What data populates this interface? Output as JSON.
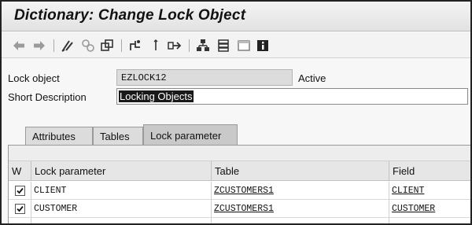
{
  "window": {
    "title": "Dictionary: Change Lock Object"
  },
  "toolbar": {
    "icons": [
      "back-arrow-icon",
      "forward-arrow-icon",
      "display-change-icon",
      "activate-icon",
      "check-icon",
      "where-used-icon",
      "other-object-icon",
      "navigate-icon",
      "object-list-icon",
      "hierarchy-icon",
      "stack-icon",
      "fullscreen-icon",
      "info-icon"
    ]
  },
  "form": {
    "lock_object_label": "Lock object",
    "lock_object_value": "EZLOCK12",
    "status": "Active",
    "short_desc_label": "Short Description",
    "short_desc_value": "Locking Objects"
  },
  "tabs": [
    {
      "label": "Attributes",
      "active": false
    },
    {
      "label": "Tables",
      "active": false
    },
    {
      "label": "Lock parameter",
      "active": true
    }
  ],
  "table": {
    "headers": [
      "W",
      "Lock parameter",
      "Table",
      "Field"
    ],
    "rows": [
      {
        "checked": true,
        "param": "CLIENT",
        "table": "ZCUSTOMERS1",
        "field": "CLIENT"
      },
      {
        "checked": true,
        "param": "CUSTOMER",
        "table": "ZCUSTOMERS1",
        "field": "CUSTOMER"
      }
    ]
  }
}
